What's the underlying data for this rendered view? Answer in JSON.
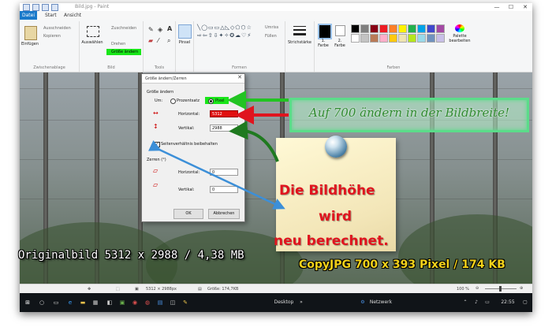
{
  "window": {
    "title": "Bild.jpg - Paint",
    "minimize": "—",
    "maximize": "☐",
    "close": "✕"
  },
  "tabs": [
    "Datei",
    "Start",
    "Ansicht"
  ],
  "ribbon": {
    "clipboard": {
      "paste": "Einfügen",
      "cut": "Ausschneiden",
      "copy": "Kopieren",
      "label": "Zwischenablage"
    },
    "image": {
      "select": "Auswählen",
      "crop": "Zuschneiden",
      "resize": "Größe ändern",
      "rotate": "Drehen",
      "label": "Bild"
    },
    "tools": {
      "label": "Tools"
    },
    "brushes": {
      "label": "Pinsel"
    },
    "shapes": {
      "outline": "Umriss",
      "fill": "Füllen",
      "label": "Formen"
    },
    "size": {
      "label": "Strichstärke"
    },
    "colors": {
      "color1": "1.\nFarbe",
      "color2": "2.\nFarbe",
      "edit": "Palette bearbeiten",
      "label": "Farben",
      "palette": [
        "#000000",
        "#7f7f7f",
        "#880015",
        "#ed1c24",
        "#ff7f27",
        "#fff200",
        "#22b14c",
        "#00a2e8",
        "#3f48cc",
        "#a349a4",
        "#ffffff",
        "#c3c3c3",
        "#b97a57",
        "#ffaec9",
        "#ffc90e",
        "#efe4b0",
        "#b5e61d",
        "#99d9ea",
        "#7092be",
        "#c8bfe7"
      ]
    }
  },
  "dialog": {
    "title": "Größe ändern/Zerren",
    "close": "✕",
    "resize_section": "Größe ändern",
    "by_label": "Um:",
    "percent_option": "Prozentsatz",
    "pixel_option": "Pixel",
    "horizontal_label": "Horizontal:",
    "horizontal_value": "5312",
    "vertical_label": "Vertikal:",
    "vertical_value": "2988",
    "keep_ratio": "Seitenverhältnis beibehalten",
    "skew_section": "Zerren (°)",
    "skew_h_label": "Horizontal:",
    "skew_h_value": "0",
    "skew_v_label": "Vertikal:",
    "skew_v_value": "0",
    "ok": "OK",
    "cancel": "Abbrechen"
  },
  "status": {
    "dimensions": "5312 × 2988px",
    "size": "Größe: 174,7KB",
    "zoom": "100 %"
  },
  "taskbar": {
    "desktop": "Desktop",
    "network": "Netzwerk",
    "time": "22:55"
  },
  "annotations": {
    "green_note": "Auf 700 ändern in der Bildbreite!",
    "red_line1": "Die Bildhöhe",
    "red_line2": "wird",
    "red_line3": "neu berechnet.",
    "original": "Originalbild 5312 x 2988 / 4,38 MB",
    "copy": "CopyJPG 700 x 393 Pixel / 174 KB"
  }
}
